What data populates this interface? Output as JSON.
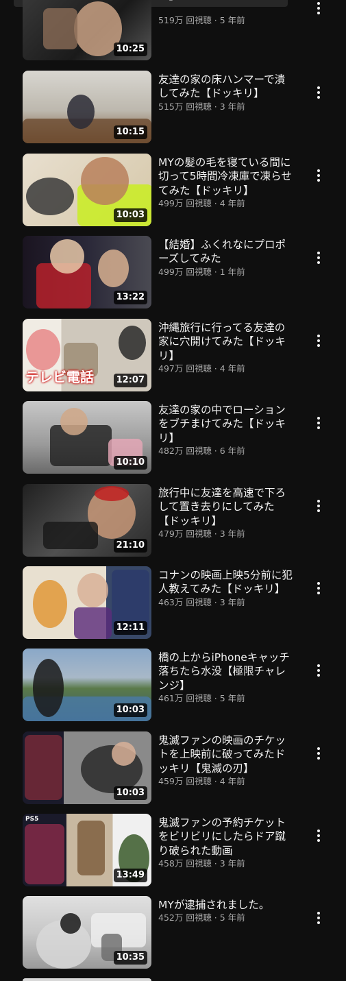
{
  "videos": [
    {
      "title": "中と外繋げてみた【ドッキリ】",
      "meta": "519万 回視聴 · 5 年前",
      "duration": "10:25"
    },
    {
      "title": "友達の家の床ハンマーで潰してみた【ドッキリ】",
      "meta": "515万 回視聴 · 3 年前",
      "duration": "10:15"
    },
    {
      "title": "MYの髪の毛を寝ている間に切って5時間冷凍庫で凍らせてみた【ドッキリ】",
      "meta": "499万 回視聴 · 4 年前",
      "duration": "10:03"
    },
    {
      "title": "【結婚】ふくれなにプロポーズしてみた",
      "meta": "499万 回視聴 · 1 年前",
      "duration": "13:22"
    },
    {
      "title": "沖縄旅行に行ってる友達の家に穴開けてみた【ドッキリ】",
      "meta": "497万 回視聴 · 4 年前",
      "duration": "12:07",
      "caption": "テレビ電話"
    },
    {
      "title": "友達の家の中でローションをブチまけてみた【ドッキリ】",
      "meta": "482万 回視聴 · 6 年前",
      "duration": "10:10"
    },
    {
      "title": "旅行中に友達を高速で下ろして置き去りにしてみた【ドッキリ】",
      "meta": "479万 回視聴 · 3 年前",
      "duration": "21:10"
    },
    {
      "title": "コナンの映画上映5分前に犯人教えてみた【ドッキリ】",
      "meta": "463万 回視聴 · 3 年前",
      "duration": "12:11"
    },
    {
      "title": "橋の上からiPhoneキャッチ落ちたら水没【極限チャレンジ】",
      "meta": "461万 回視聴 · 5 年前",
      "duration": "10:03"
    },
    {
      "title": "鬼滅ファンの映画のチケットを上映前に破ってみたドッキリ【鬼滅の刃】",
      "meta": "459万 回視聴 · 4 年前",
      "duration": "10:03"
    },
    {
      "title": "鬼滅ファンの予約チケットをビリビリにしたらドア蹴り破られた動画",
      "meta": "458万 回視聴 · 3 年前",
      "duration": "13:49",
      "badge": "PS5"
    },
    {
      "title": "MYが逮捕されました。",
      "meta": "452万 回視聴 · 5 年前",
      "duration": "10:35"
    }
  ],
  "colors": {
    "background": "#0f0f0f",
    "title": "#f1f1f1",
    "meta": "#aaaaaa"
  },
  "icons": {
    "more": "more-vert-icon"
  }
}
